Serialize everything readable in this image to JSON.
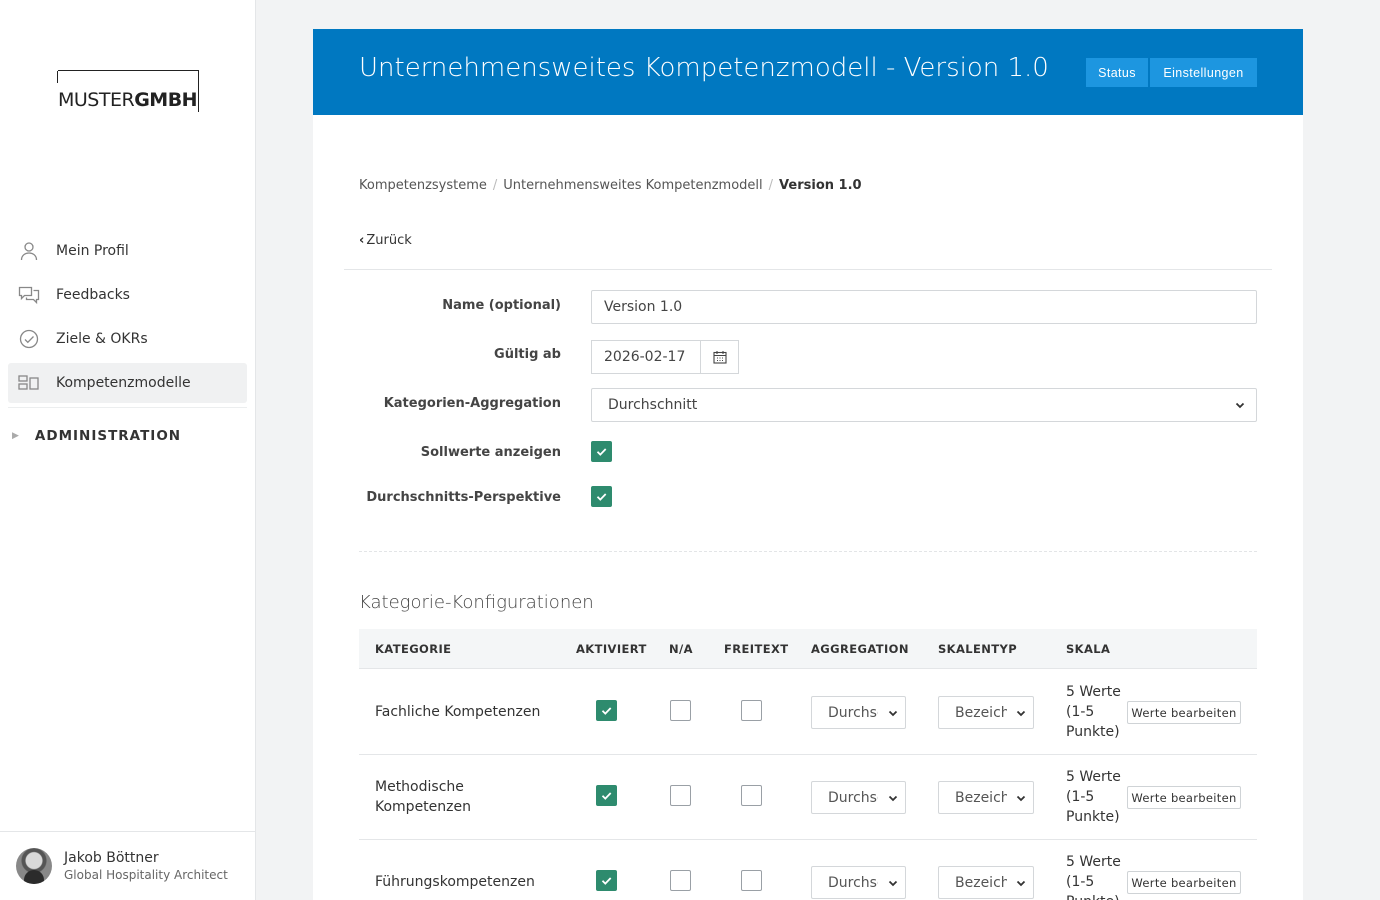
{
  "logo": {
    "part1": "MUSTER",
    "part2": "GMBH"
  },
  "sidebar": {
    "items": [
      {
        "label": "Mein Profil",
        "icon": "user-icon"
      },
      {
        "label": "Feedbacks",
        "icon": "chat-bubbles-icon"
      },
      {
        "label": "Ziele & OKRs",
        "icon": "check-circle-icon"
      },
      {
        "label": "Kompetenzmodelle",
        "icon": "competency-model-icon",
        "active": true
      }
    ],
    "admin": "ADMINISTRATION"
  },
  "user": {
    "name": "Jakob Böttner",
    "role": "Global Hospitality Architect"
  },
  "header": {
    "title": "Unternehmensweites Kompetenzmodell - Version 1.0",
    "status_btn": "Status",
    "settings_btn": "Einstellungen",
    "color": "#0078c1"
  },
  "breadcrumb": {
    "items": [
      "Kompetenzsysteme",
      "Unternehmensweites Kompetenzmodell"
    ],
    "current": "Version 1.0"
  },
  "back": "Zurück",
  "form": {
    "name_label": "Name (optional)",
    "name_value": "Version 1.0",
    "valid_label": "Gültig ab",
    "valid_value": "2026-02-17",
    "agg_label": "Kategorien-Aggregation",
    "agg_value": "Durchschnitt",
    "targets_label": "Sollwerte anzeigen",
    "targets_checked": true,
    "avg_label": "Durchschnitts-Perspektive",
    "avg_checked": true
  },
  "categories": {
    "title": "Kategorie-Konfigurationen",
    "headers": {
      "kategorie": "KATEGORIE",
      "aktiviert": "AKTIVIERT",
      "na": "N/A",
      "freitext": "FREITEXT",
      "aggregation": "AGGREGATION",
      "skalentyp": "SKALENTYP",
      "skala": "SKALA"
    },
    "edit_label": "Werte bearbeiten",
    "rows": [
      {
        "name": "Fachliche Kompetenzen",
        "aktiviert": true,
        "na": false,
        "freitext": false,
        "aggregation": "Durchschnitt",
        "skalentyp": "Bezeichnung",
        "skala_l1": "5 Werte",
        "skala_l2": "(1-5",
        "skala_l3": "Punkte)"
      },
      {
        "name": "Methodische Kompetenzen",
        "aktiviert": true,
        "na": false,
        "freitext": false,
        "aggregation": "Durchschnitt",
        "skalentyp": "Bezeichnung",
        "skala_l1": "5 Werte",
        "skala_l2": "(1-5",
        "skala_l3": "Punkte)"
      },
      {
        "name": "Führungskompetenzen",
        "aktiviert": true,
        "na": false,
        "freitext": false,
        "aggregation": "Durchschnitt",
        "skalentyp": "Bezeichnung",
        "skala_l1": "5 Werte",
        "skala_l2": "(1-5",
        "skala_l3": "Punkte)"
      }
    ]
  }
}
